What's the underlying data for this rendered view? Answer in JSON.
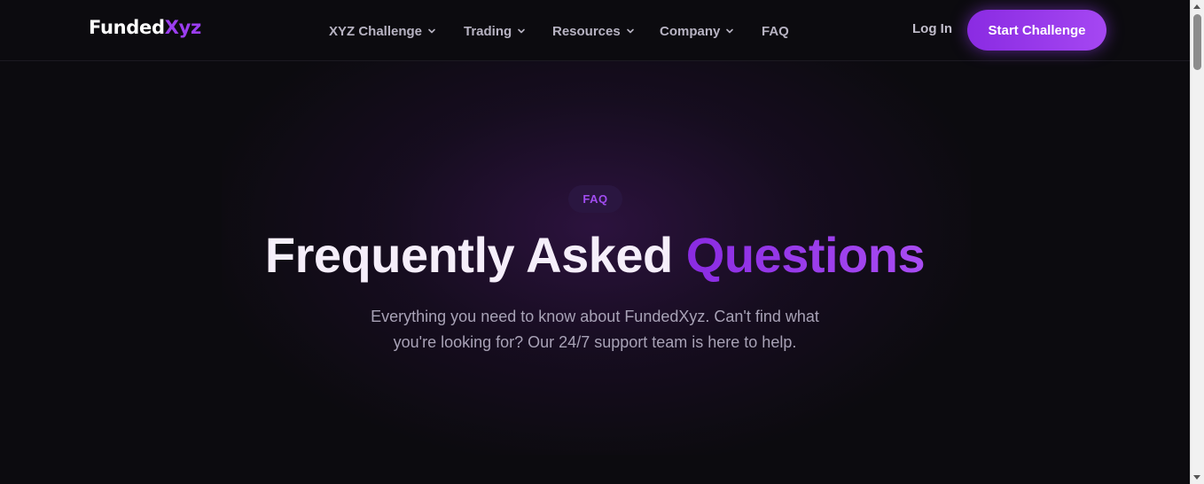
{
  "header": {
    "logo": {
      "main": "Funded",
      "accent": "Xyz"
    },
    "nav": [
      {
        "label": "XYZ Challenge",
        "has_dropdown": true
      },
      {
        "label": "Trading",
        "has_dropdown": true
      },
      {
        "label": "Resources",
        "has_dropdown": true
      },
      {
        "label": "Company",
        "has_dropdown": true
      },
      {
        "label": "FAQ",
        "has_dropdown": false
      }
    ],
    "login_label": "Log In",
    "cta_label": "Start Challenge"
  },
  "hero": {
    "badge": "FAQ",
    "title_main": "Frequently Asked",
    "title_accent": "Questions",
    "subtitle_line1": "Everything you need to know about FundedXyz. Can't find what",
    "subtitle_line2": "you're looking for? Our 24/7 support team is here to help."
  },
  "icons": {
    "chevron": "chevron-down-icon"
  },
  "colors": {
    "background": "#0c0b0f",
    "accent": "#9b3df0",
    "nav_text": "#b7b3c2",
    "subtitle_text": "#a8a2b6"
  }
}
